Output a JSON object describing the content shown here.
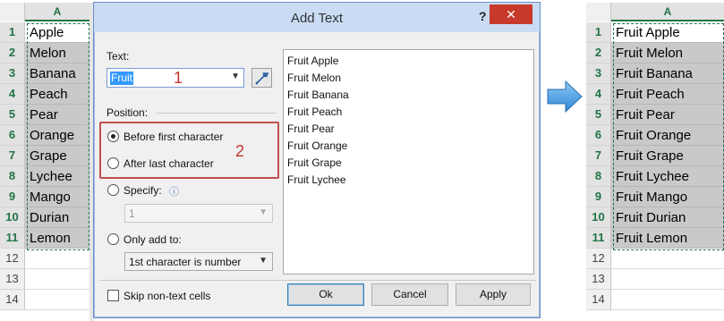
{
  "left_sheet": {
    "column_header": "A",
    "rows": [
      "1",
      "2",
      "3",
      "4",
      "5",
      "6",
      "7",
      "8",
      "9",
      "10",
      "11",
      "12",
      "13",
      "14"
    ],
    "values": [
      "Apple",
      "Melon",
      "Banana",
      "Peach",
      "Pear",
      "Orange",
      "Grape",
      "Lychee",
      "Mango",
      "Durian",
      "Lemon"
    ]
  },
  "right_sheet": {
    "column_header": "A",
    "rows": [
      "1",
      "2",
      "3",
      "4",
      "5",
      "6",
      "7",
      "8",
      "9",
      "10",
      "11",
      "12",
      "13",
      "14"
    ],
    "values": [
      "Fruit Apple",
      "Fruit Melon",
      "Fruit Banana",
      "Fruit Peach",
      "Fruit Pear",
      "Fruit Orange",
      "Fruit Grape",
      "Fruit Lychee",
      "Fruit Mango",
      "Fruit Durian",
      "Fruit Lemon"
    ]
  },
  "dialog": {
    "title": "Add Text",
    "help": "?",
    "close": "✕",
    "text_label": "Text:",
    "text_value": "Fruit",
    "position_label": "Position:",
    "before_first": "Before first character",
    "after_last": "After last character",
    "specify": "Specify:",
    "specify_value": "1",
    "only_add_to": "Only add to:",
    "only_add_value": "1st character is number",
    "skip_label": "Skip non-text cells",
    "preview_items": [
      "Fruit Apple",
      "Fruit Melon",
      "Fruit Banana",
      "Fruit Peach",
      "Fruit Pear",
      "Fruit Orange",
      "Fruit Grape",
      "Fruit Lychee"
    ],
    "ok": "Ok",
    "cancel": "Cancel",
    "apply": "Apply",
    "badge_1": "1",
    "badge_2": "2"
  },
  "colors": {
    "excel_green": "#217346",
    "annotation_red": "#c0504d",
    "arrow_blue": "#3a8fd8"
  }
}
